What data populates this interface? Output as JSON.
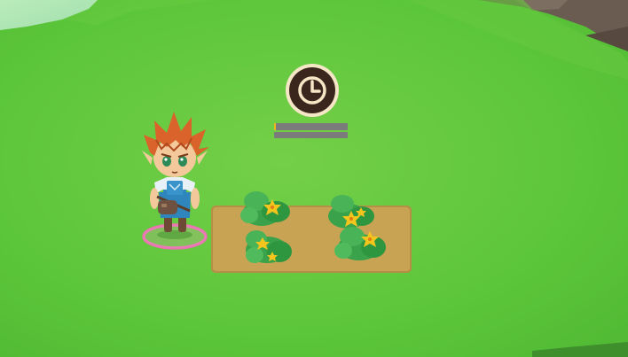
{
  "scene": {
    "type": "farm-field",
    "colors": {
      "grass_main": "#5cc63a",
      "grass_light": "#79cf4f",
      "grass_shadow": "#4fae35",
      "sky_top_left": "#d8f4f3",
      "rock": "#6b5c52",
      "soil_plot": "#c9a354",
      "timer_ring": "#f5e6c6",
      "timer_face": "#3b261d",
      "progress_track": "#7b7b7b",
      "progress_fill": "#e9ba22",
      "selection_ring": "#ff66c4"
    }
  },
  "timer": {
    "icon": "clock-icon",
    "progress": 0.02,
    "second_bar_progress": 0.0
  },
  "player": {
    "icon": "farmer-character",
    "selected": true
  },
  "plot": {
    "crop_icon": "squash-plant-icon",
    "plants": [
      {
        "id": "plant-1"
      },
      {
        "id": "plant-2"
      },
      {
        "id": "plant-3"
      },
      {
        "id": "plant-4"
      }
    ]
  }
}
